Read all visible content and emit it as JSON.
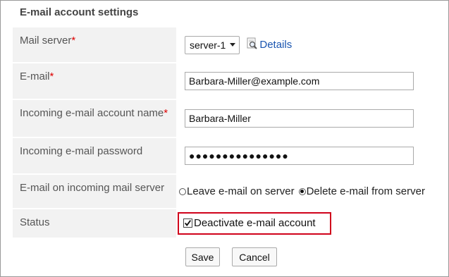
{
  "section_title": "E-mail account settings",
  "fields": {
    "mail_server": {
      "label": "Mail server",
      "required": "*",
      "selected": "server-1",
      "details_link": "Details"
    },
    "email": {
      "label": "E-mail",
      "required": "*",
      "value": "Barbara-Miller@example.com"
    },
    "incoming_name": {
      "label": "Incoming e-mail account name",
      "required": "*",
      "value": "Barbara-Miller"
    },
    "incoming_password": {
      "label": "Incoming e-mail password",
      "masked": "●●●●●●●●●●●●●●●"
    },
    "server_option": {
      "label": "E-mail on incoming mail server",
      "options": [
        "Leave e-mail on server",
        "Delete e-mail from server"
      ],
      "selected": "Delete e-mail from server"
    },
    "status": {
      "label": "Status",
      "checkbox_label": "Deactivate e-mail account",
      "checked": true
    }
  },
  "buttons": {
    "save": "Save",
    "cancel": "Cancel"
  },
  "colors": {
    "highlight": "#d0021b",
    "link": "#1a55b0",
    "label_bg": "#f2f2f2",
    "required": "#dd0000"
  }
}
